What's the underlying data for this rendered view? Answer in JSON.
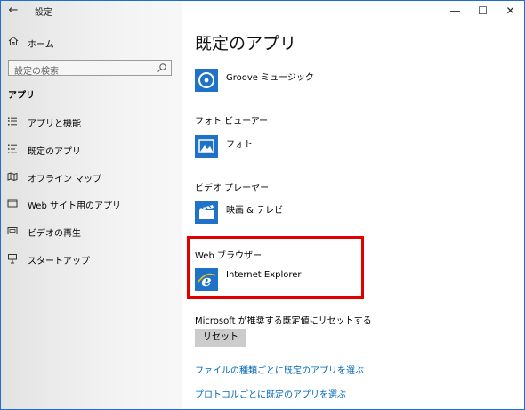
{
  "window": {
    "title": "設定",
    "back_glyph": "←",
    "minimize": "—",
    "maximize": "☐",
    "close": "✕"
  },
  "sidebar": {
    "home_label": "ホーム",
    "search_placeholder": "設定の検索",
    "section_header": "アプリ",
    "items": [
      {
        "label": "アプリと機能",
        "icon": "apps-features-icon"
      },
      {
        "label": "既定のアプリ",
        "icon": "default-apps-icon"
      },
      {
        "label": "オフライン マップ",
        "icon": "offline-maps-icon"
      },
      {
        "label": "Web サイト用のアプリ",
        "icon": "apps-for-websites-icon"
      },
      {
        "label": "ビデオの再生",
        "icon": "video-playback-icon"
      },
      {
        "label": "スタートアップ",
        "icon": "startup-icon"
      }
    ]
  },
  "main": {
    "page_title": "既定のアプリ",
    "music": {
      "app_name": "Groove ミュージック"
    },
    "photo": {
      "category": "フォト ビューアー",
      "app_name": "フォト"
    },
    "video": {
      "category": "ビデオ プレーヤー",
      "app_name": "映画 & テレビ"
    },
    "browser": {
      "category": "Web ブラウザー",
      "app_name": "Internet Explorer"
    },
    "reset": {
      "label": "Microsoft が推奨する既定値にリセットする",
      "button": "リセット"
    },
    "links": [
      "ファイルの種類ごとに既定のアプリを選ぶ",
      "プロトコルごとに既定のアプリを選ぶ"
    ]
  },
  "colors": {
    "accent": "#0067b8",
    "tile_blue": "#1e73c8",
    "highlight_red": "#e00000"
  }
}
